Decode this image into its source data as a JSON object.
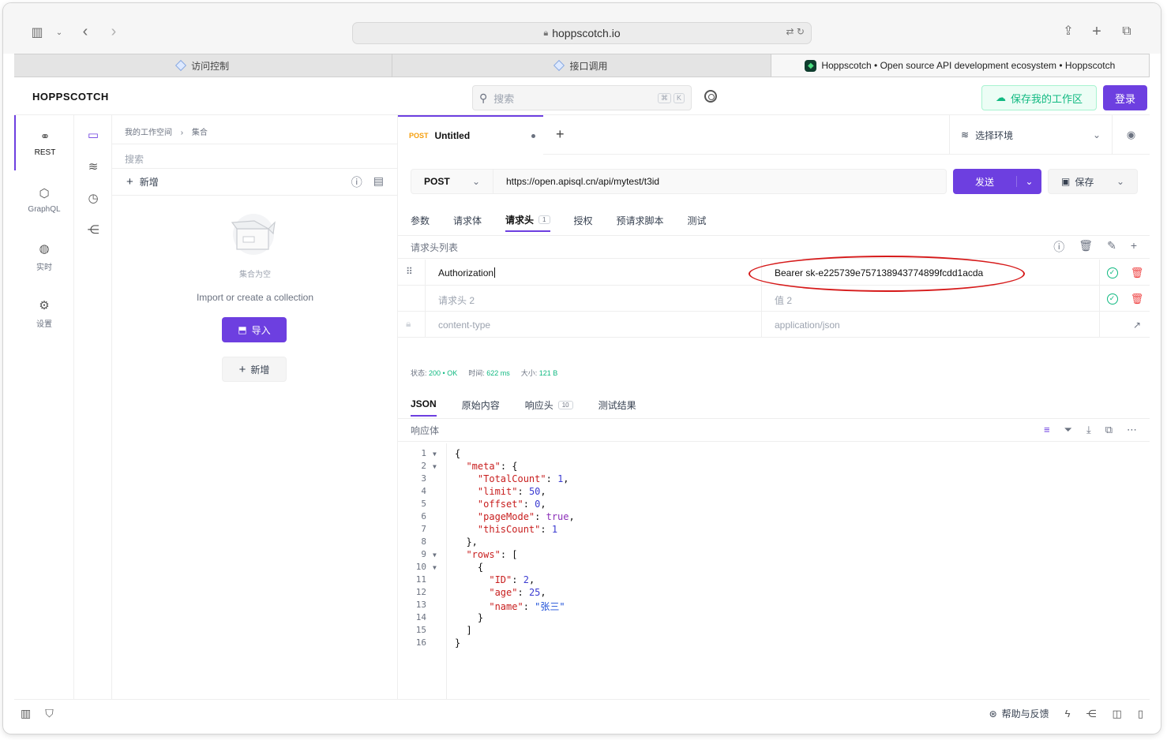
{
  "browser": {
    "url": "hoppscotch.io",
    "tabs": [
      {
        "label": "访问控制",
        "active": false
      },
      {
        "label": "接口调用",
        "active": false
      },
      {
        "label": "Hoppscotch • Open source API development ecosystem • Hoppscotch",
        "active": true
      }
    ]
  },
  "header": {
    "brand": "HOPPSCOTCH",
    "search_placeholder": "搜索",
    "kbd1": "⌘",
    "kbd2": "K",
    "save_workspace": "保存我的工作区",
    "login": "登录"
  },
  "rail": {
    "items": [
      {
        "label": "REST",
        "icon": "link-icon",
        "glyph": "⚭"
      },
      {
        "label": "GraphQL",
        "icon": "graphql-icon",
        "glyph": "⬡"
      },
      {
        "label": "实时",
        "icon": "globe-icon",
        "glyph": "◍"
      },
      {
        "label": "设置",
        "icon": "settings-icon",
        "glyph": "⚙"
      }
    ]
  },
  "collections": {
    "breadcrumb_workspace": "我的工作空间",
    "breadcrumb_section": "集合",
    "search_placeholder": "搜索",
    "new_label": "新增",
    "empty_title": "集合为空",
    "empty_sub": "Import or create a collection",
    "import_label": "导入",
    "new2_label": "新增"
  },
  "request": {
    "tab_method": "POST",
    "tab_title": "Untitled",
    "environment": "选择环境",
    "method": "POST",
    "url": "https://open.apisql.cn/api/mytest/t3id",
    "send": "发送",
    "save": "保存",
    "subtabs": [
      {
        "label": "参数",
        "active": false
      },
      {
        "label": "请求体",
        "active": false
      },
      {
        "label": "请求头",
        "active": true,
        "badge": "1"
      },
      {
        "label": "授权",
        "active": false
      },
      {
        "label": "预请求脚本",
        "active": false
      },
      {
        "label": "测试",
        "active": false
      }
    ],
    "headers_list_label": "请求头列表",
    "headers": [
      {
        "key": "Authorization",
        "value": "Bearer sk-e225739e757138943774899fcdd1acda"
      },
      {
        "key_placeholder": "请求头 2",
        "value_placeholder": "值 2"
      },
      {
        "key_placeholder": "content-type",
        "value_placeholder": "application/json"
      }
    ]
  },
  "response": {
    "status_label": "状态:",
    "status_value": "200 • OK",
    "time_label": "时间:",
    "time_value": "622 ms",
    "size_label": "大小:",
    "size_value": "121 B",
    "tabs": [
      {
        "label": "JSON",
        "active": true
      },
      {
        "label": "原始内容",
        "active": false
      },
      {
        "label": "响应头",
        "active": false,
        "badge": "10"
      },
      {
        "label": "测试结果",
        "active": false
      }
    ],
    "body_label": "响应体",
    "lines": [
      "{",
      "  \"meta\": {",
      "    \"TotalCount\": 1,",
      "    \"limit\": 50,",
      "    \"offset\": 0,",
      "    \"pageMode\": true,",
      "    \"thisCount\": 1",
      "  },",
      "  \"rows\": [",
      "    {",
      "      \"ID\": 2,",
      "      \"age\": 25,",
      "      \"name\": \"张三\"",
      "    }",
      "  ]",
      "}"
    ],
    "folds": [
      1,
      2,
      9,
      10
    ]
  },
  "footer": {
    "help": "帮助与反馈"
  },
  "colors": {
    "accent": "#6d3fe0",
    "success": "#10b981",
    "danger": "#ef4444",
    "annotation": "#d61a1a"
  }
}
